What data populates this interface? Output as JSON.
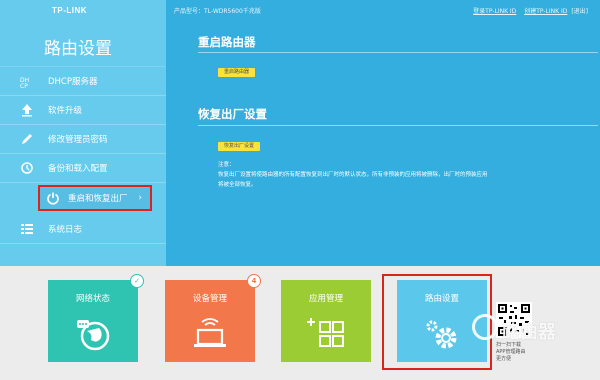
{
  "brand": {
    "logo_text": "TP-LINK"
  },
  "topbar": {
    "model": "产品型号：TL-WDR5600千兆版",
    "login_link": "登录TP-LINK ID",
    "create_link": "创建TP-LINK ID",
    "exit_link": "[退出]"
  },
  "sidebar": {
    "title": "路由设置",
    "items": [
      {
        "label": "DHCP服务器",
        "icon": "dhcp-icon"
      },
      {
        "label": "软件升级",
        "icon": "upload-icon"
      },
      {
        "label": "修改管理员密码",
        "icon": "pencil-icon"
      },
      {
        "label": "备份和载入配置",
        "icon": "backup-icon"
      },
      {
        "label": "重启和恢复出厂",
        "icon": "power-icon",
        "active": true
      },
      {
        "label": "系统日志",
        "icon": "list-icon"
      }
    ]
  },
  "main": {
    "reboot": {
      "title": "重启路由器",
      "button": "重启路由器"
    },
    "restore": {
      "title": "恢复出厂设置",
      "button": "恢复出厂设置",
      "note_title": "注意：",
      "note_line1": "恢复出厂设置将使路由器的所有配置恢复到出厂时的默认状态，所有非预装的应用将被删除，出厂时的预装应用",
      "note_line2": "将被全部恢复。"
    }
  },
  "tiles": [
    {
      "label": "网络状态",
      "color": "#2ec4b1",
      "badge": "✓"
    },
    {
      "label": "设备管理",
      "color": "#f2784b",
      "badge": "4"
    },
    {
      "label": "应用管理",
      "color": "#9ccc34"
    },
    {
      "label": "路由设置",
      "color": "#5bc8eb"
    }
  ],
  "qr": {
    "caption_line1": "扫一扫下载",
    "caption_line2": "APP管理路由",
    "caption_line3": "更方便"
  },
  "watermark": {
    "text": "路由器"
  },
  "colors": {
    "sidebar": "#66cbed",
    "content": "#33aede",
    "highlight": "#d9251c",
    "button": "#f6e43a"
  }
}
